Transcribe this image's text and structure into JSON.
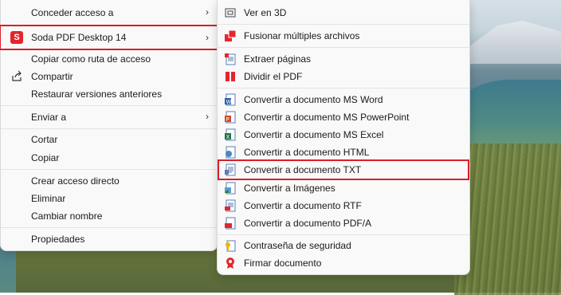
{
  "main_menu": {
    "items": [
      {
        "label": "Conceder acceso a",
        "has_submenu": true
      },
      {
        "label": "Soda PDF Desktop 14",
        "has_submenu": true,
        "icon_letter": "S"
      },
      {
        "label": "Copiar como ruta de acceso"
      },
      {
        "label": "Compartir"
      },
      {
        "label": "Restaurar versiones anteriores"
      },
      {
        "label": "Enviar a",
        "has_submenu": true
      },
      {
        "label": "Cortar"
      },
      {
        "label": "Copiar"
      },
      {
        "label": "Crear acceso directo"
      },
      {
        "label": "Eliminar"
      },
      {
        "label": "Cambiar nombre"
      },
      {
        "label": "Propiedades"
      }
    ],
    "chevron": "›"
  },
  "sub_menu": {
    "items": [
      {
        "label": "Ver en 3D"
      },
      {
        "label": "Fusionar múltiples archivos"
      },
      {
        "label": "Extraer páginas"
      },
      {
        "label": "Dividir el PDF"
      },
      {
        "label": "Convertir a documento MS Word"
      },
      {
        "label": "Convertir a documento MS PowerPoint"
      },
      {
        "label": "Convertir a documento MS Excel"
      },
      {
        "label": "Convertir a documento HTML"
      },
      {
        "label": "Convertir a documento TXT"
      },
      {
        "label": "Convertir a Imágenes"
      },
      {
        "label": "Convertir a documento RTF"
      },
      {
        "label": "Convertir a documento PDF/A"
      },
      {
        "label": "Contraseña de seguridad"
      },
      {
        "label": "Firmar documento"
      }
    ]
  },
  "colors": {
    "highlight": "#d81f2a",
    "brand_red": "#e4262c",
    "menu_bg": "#f9f9f9"
  }
}
